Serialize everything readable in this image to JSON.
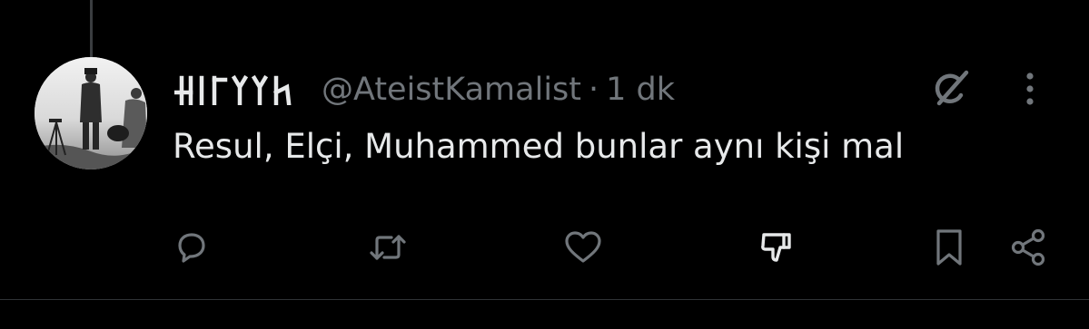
{
  "tweet": {
    "display_name": "Göktürk script name",
    "handle": "@AteistKamalist",
    "separator": "·",
    "time": "1 dk",
    "text": "Resul, Elçi, Muhammed bunlar aynı kişi mal"
  },
  "icons": {
    "grok": "grok-icon",
    "more": "more-vertical-icon",
    "reply": "reply-icon",
    "retweet": "retweet-icon",
    "like": "like-icon",
    "dislike": "dislike-icon",
    "bookmark": "bookmark-icon",
    "share": "share-icon"
  },
  "colors": {
    "background": "#000000",
    "text_primary": "#e7e9ea",
    "text_secondary": "#71767b",
    "icon": "#71767b",
    "divider": "#2f3336"
  }
}
